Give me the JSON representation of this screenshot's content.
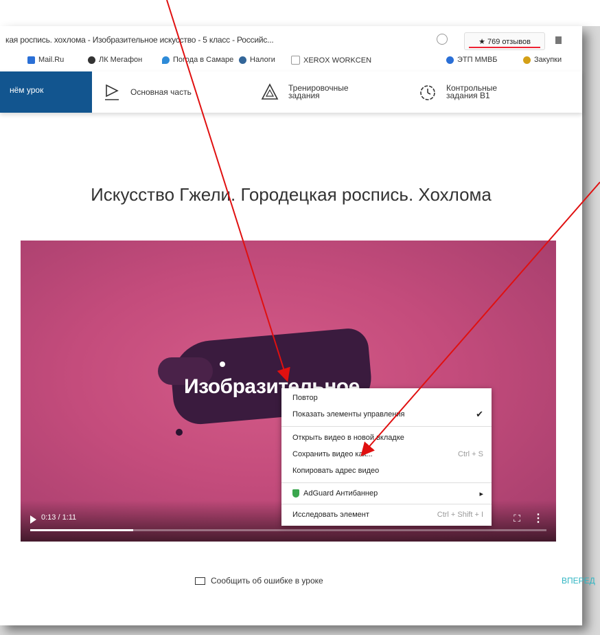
{
  "browser": {
    "tab_title": "кая роспись. хохлома - Изобразительное искусство - 5 класс - Российс...",
    "reviews_label": "★ 769 отзывов"
  },
  "bookmarks": [
    {
      "label": "Mail.Ru",
      "color": "#2a6fd6"
    },
    {
      "label": "ЛК Мегафон",
      "color": "#333333"
    },
    {
      "label": "Погода в Самаре",
      "color": "#2e8bd8"
    },
    {
      "label": "Налоги",
      "color": "#336699"
    },
    {
      "label": "XEROX WORKCEN",
      "color": "#bbbbbb"
    },
    {
      "label": "ЭТП ММВБ",
      "color": "#2a6fd6"
    },
    {
      "label": "Закупки",
      "color": "#d4a017"
    }
  ],
  "nav": {
    "active": "нём урок",
    "items": [
      "Основная часть",
      "Тренировочные задания",
      "Контрольные задания B1"
    ]
  },
  "lesson": {
    "title": "Искусство Гжели. Городецкая роспись. Хохлома"
  },
  "video": {
    "overlay_text": "Изобразительное",
    "time": "0:13 / 1:11",
    "progress": 0.2
  },
  "context_menu": {
    "items": [
      {
        "label": "Повтор",
        "shortcut": ""
      },
      {
        "label": "Показать элементы управления",
        "shortcut": "✔"
      },
      {
        "label": "Открыть видео в новой вкладке",
        "shortcut": ""
      },
      {
        "label": "Сохранить видео как...",
        "shortcut": "Ctrl + S"
      },
      {
        "label": "Копировать адрес видео",
        "shortcut": ""
      },
      {
        "label": "AdGuard Антибаннер",
        "shortcut": "▸"
      },
      {
        "label": "Исследовать элемент",
        "shortcut": "Ctrl + Shift + I"
      }
    ]
  },
  "footer": {
    "report": "Сообщить об ошибке в уроке",
    "forward": "ВПЕРЕД"
  }
}
